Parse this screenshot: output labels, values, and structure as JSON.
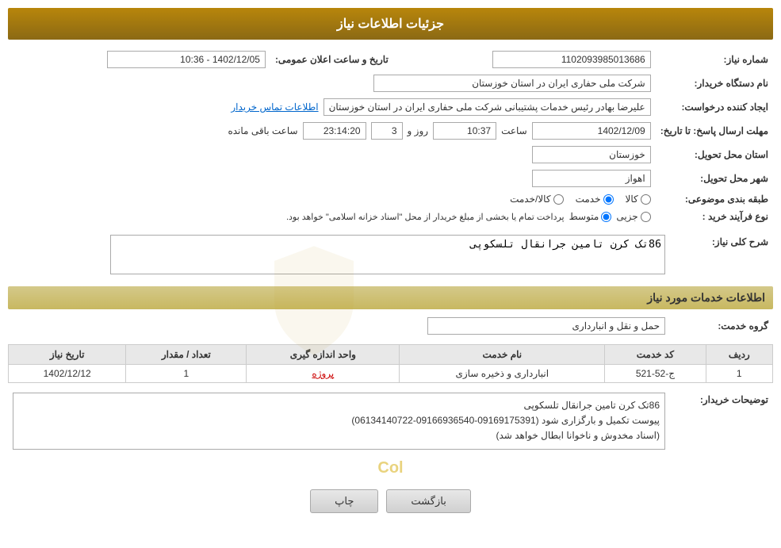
{
  "header": {
    "title": "جزئیات اطلاعات نیاز"
  },
  "fields": {
    "need_number_label": "شماره نیاز:",
    "need_number_value": "1102093985013686",
    "buyer_org_label": "نام دستگاه خریدار:",
    "buyer_org_value": "شرکت ملی حفاری ایران در استان خوزستان",
    "announcement_datetime_label": "تاریخ و ساعت اعلان عمومی:",
    "announcement_datetime_value": "1402/12/05 - 10:36",
    "creator_label": "ایجاد کننده درخواست:",
    "creator_value": "علیرضا بهادر رئیس خدمات پشتیبانی شرکت ملی حفاری ایران در استان خوزستان",
    "contact_link": "اطلاعات تماس خریدار",
    "response_deadline_label": "مهلت ارسال پاسخ: تا تاریخ:",
    "response_date": "1402/12/09",
    "response_time_label": "ساعت",
    "response_time": "10:37",
    "response_days_label": "روز و",
    "response_days": "3",
    "response_remaining_label": "ساعت باقی مانده",
    "response_remaining": "23:14:20",
    "delivery_province_label": "استان محل تحویل:",
    "delivery_province_value": "خوزستان",
    "delivery_city_label": "شهر محل تحویل:",
    "delivery_city_value": "اهواز",
    "category_label": "طبقه بندی موضوعی:",
    "category_options": [
      "کالا",
      "خدمت",
      "کالا/خدمت"
    ],
    "category_selected": "خدمت",
    "process_type_label": "نوع فرآیند خرید :",
    "process_options": [
      "جزیی",
      "متوسط"
    ],
    "process_note": "پرداخت تمام یا بخشی از مبلغ خریدار از محل \"اسناد خزانه اسلامی\" خواهد بود.",
    "need_description_label": "شرح کلی نیاز:",
    "need_description_value": "86تک کرن تامین جرانقال تلسکوپی",
    "services_section": "اطلاعات خدمات مورد نیاز",
    "service_group_label": "گروه خدمت:",
    "service_group_value": "حمل و نقل و انبارداری",
    "table_headers": [
      "ردیف",
      "کد خدمت",
      "نام خدمت",
      "واحد اندازه گیری",
      "تعداد / مقدار",
      "تاریخ نیاز"
    ],
    "table_rows": [
      {
        "row": "1",
        "service_code": "ج-52-521",
        "service_name": "انبارداری و ذخیره سازی",
        "unit": "پروژه",
        "quantity": "1",
        "date": "1402/12/12"
      }
    ],
    "buyer_description_label": "توضیحات خریدار:",
    "buyer_description_value": "86تک کرن تامین جرانقال تلسکوپی\nپیوست تکمیل و بارگزاری شود (09169175391-09166936540-06134140722)\n(اسناد مخدوش و ناخوانا ابطال خواهد شد)"
  },
  "buttons": {
    "back_label": "بازگشت",
    "print_label": "چاپ"
  },
  "watermark": {
    "col_text": "Col"
  }
}
